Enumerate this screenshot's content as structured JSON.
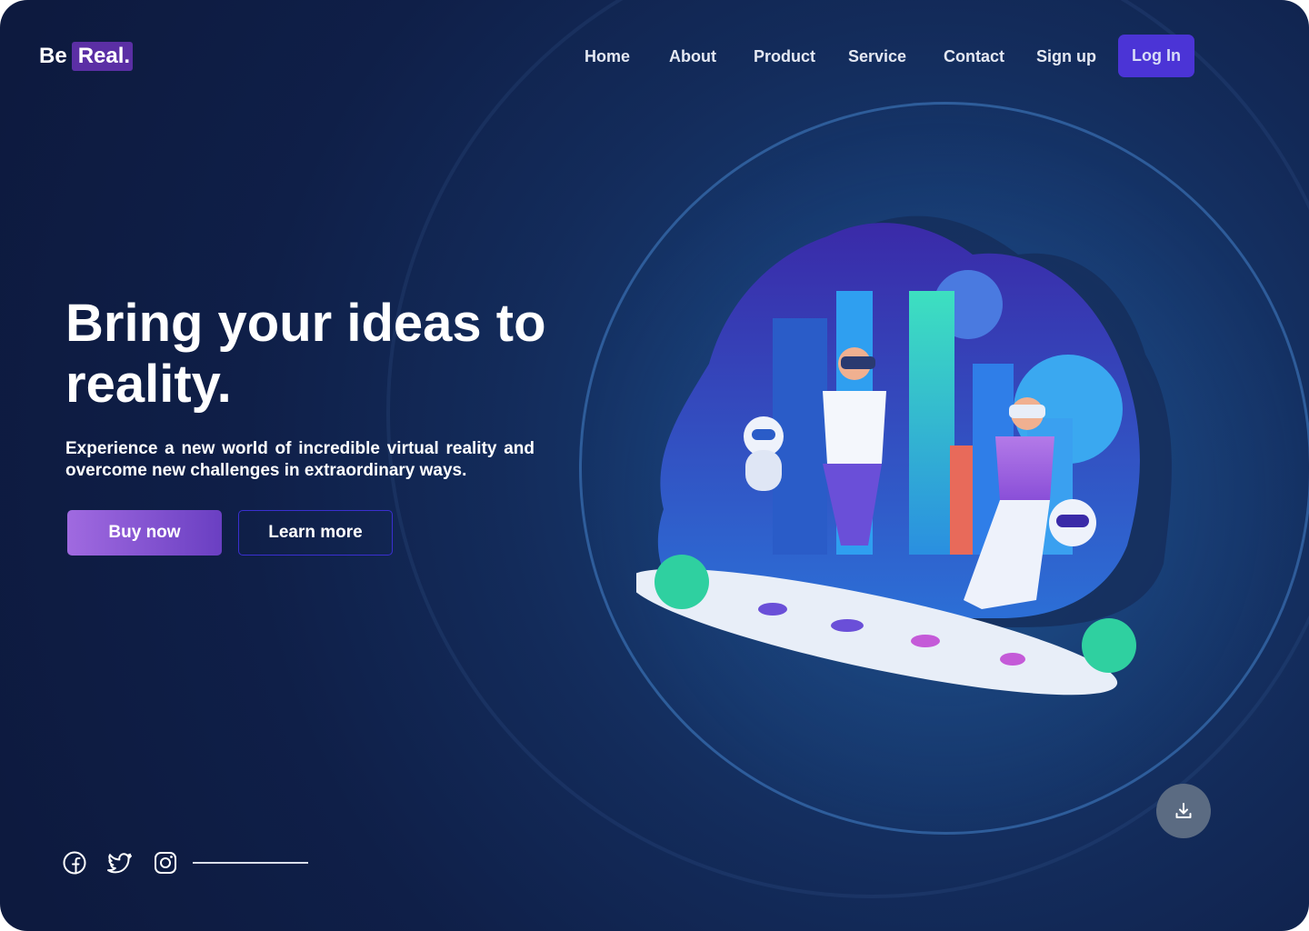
{
  "brand": {
    "be": "Be",
    "real": "Real."
  },
  "nav": {
    "items": [
      "Home",
      "About",
      "Product",
      "Service",
      "Contact",
      "Sign up"
    ],
    "login": "Log In"
  },
  "hero": {
    "title": "Bring your ideas to reality.",
    "subtitle": "Experience a new world of incredible virtual reality and overcome new challenges in extraordinary ways.",
    "primary_cta": "Buy now",
    "secondary_cta": "Learn more"
  },
  "social": {
    "icons": [
      "facebook-icon",
      "twitter-icon",
      "instagram-icon"
    ]
  },
  "download_icon": "download-icon",
  "colors": {
    "background": "#0f1f48",
    "accent_purple": "#5b2fa5",
    "login_blue": "#4b34d6",
    "buy_gradient_start": "#a06ae0",
    "buy_gradient_end": "#6a3fc2"
  }
}
